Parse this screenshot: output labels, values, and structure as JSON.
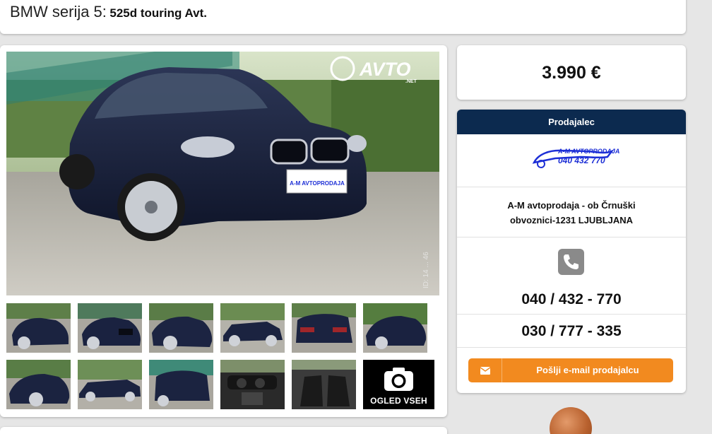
{
  "listing": {
    "model": "BMW serija 5:",
    "variant": "525d touring Avt."
  },
  "gallery": {
    "watermark_brand": "AVTO",
    "watermark_suffix": ".NET",
    "plate_text": "A-M AVTOPRODAJA",
    "photo_id": "ID: 14 ... 46",
    "view_all_label": "OGLED VSEH",
    "thumbnails": [
      "front-left view",
      "front view",
      "front-left close view",
      "side view",
      "rear view",
      "front view with greenery",
      "front-left 3/4 view",
      "side profile view",
      "rear 3/4 view",
      "interior dashboard",
      "interior seats"
    ]
  },
  "price": "3.990 €",
  "seller": {
    "header": "Prodajalec",
    "logo_name": "A-M AVTOPRODAJA",
    "logo_phone": "040 432 770",
    "address_line1": "A-M avtoprodaja - ob Črnuški",
    "address_line2": "obvoznici-1231 LJUBLJANA",
    "phone1": "040 / 432 - 770",
    "phone2": "030 / 777 - 335",
    "email_button": "Pošlji e-mail prodajalcu"
  },
  "colors": {
    "seller_header": "#0c2a4f",
    "email_button": "#f28a1f",
    "logo_blue": "#1d2fd6",
    "car_body": "#1b2340"
  }
}
